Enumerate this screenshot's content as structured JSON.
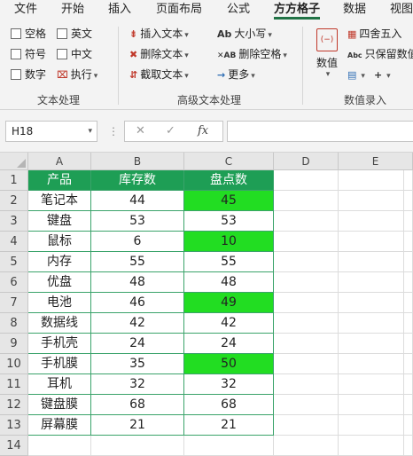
{
  "tabs": [
    "文件",
    "开始",
    "插入",
    "页面布局",
    "公式",
    "方方格子",
    "数据",
    "视图"
  ],
  "active_tab_index": 5,
  "ribbon": {
    "text_group": {
      "checkboxes": [
        "空格",
        "英文",
        "符号",
        "中文",
        "数字"
      ],
      "execute_label": "执行",
      "label": "文本处理"
    },
    "advanced_group": {
      "insert_text": "插入文本",
      "delete_text": "删除文本",
      "extract_text": "截取文本",
      "case": "大小写",
      "delete_space": "删除空格",
      "more": "更多",
      "label": "高级文本处理"
    },
    "number_group": {
      "value_label": "数值",
      "round": "四舍五入",
      "keep_value": "只保留数值",
      "label": "数值录入"
    }
  },
  "formula_bar": {
    "name_box": "H18",
    "fx": "fx",
    "formula": ""
  },
  "columns": [
    "A",
    "B",
    "C",
    "D",
    "E"
  ],
  "rows": [
    "1",
    "2",
    "3",
    "4",
    "5",
    "6",
    "7",
    "8",
    "9",
    "10",
    "11",
    "12",
    "13",
    "14"
  ],
  "table": {
    "headers": [
      "产品",
      "库存数",
      "盘点数"
    ],
    "data": [
      [
        "笔记本",
        "44",
        "45"
      ],
      [
        "键盘",
        "53",
        "53"
      ],
      [
        "鼠标",
        "6",
        "10"
      ],
      [
        "内存",
        "55",
        "55"
      ],
      [
        "优盘",
        "48",
        "48"
      ],
      [
        "电池",
        "46",
        "49"
      ],
      [
        "数据线",
        "42",
        "42"
      ],
      [
        "手机壳",
        "24",
        "24"
      ],
      [
        "手机膜",
        "35",
        "50"
      ],
      [
        "耳机",
        "32",
        "32"
      ],
      [
        "键盘膜",
        "68",
        "68"
      ],
      [
        "屏幕膜",
        "21",
        "21"
      ]
    ],
    "highlighted_rows": [
      0,
      2,
      5,
      8
    ]
  },
  "colors": {
    "header_fill": "#1e9e55",
    "highlight_fill": "#22dd22",
    "table_border": "#3aa36a"
  }
}
